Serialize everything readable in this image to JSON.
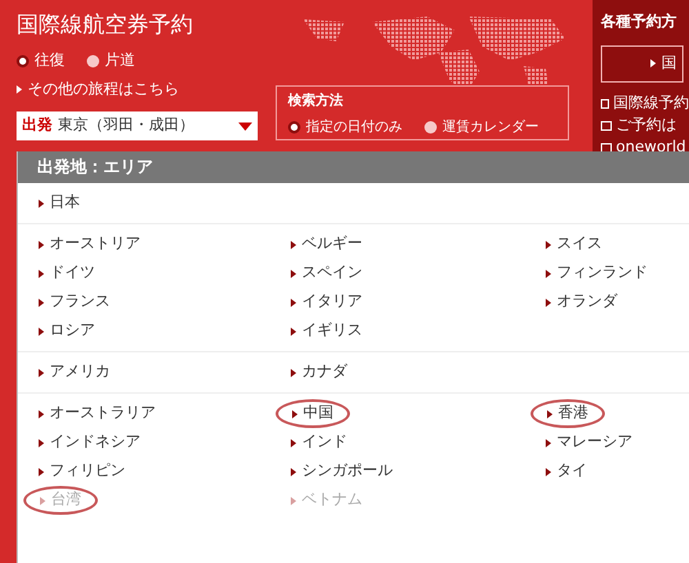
{
  "header": {
    "title": "国際線航空券予約",
    "trip_types": [
      {
        "label": "往復",
        "selected": true
      },
      {
        "label": "片道",
        "selected": false
      }
    ],
    "other_link": "その他の旅程はこちら",
    "departure": {
      "label": "出発",
      "value": "東京（羽田・成田）"
    },
    "search_method": {
      "title": "検索方法",
      "options": [
        {
          "label": "指定の日付のみ",
          "selected": true
        },
        {
          "label": "運賃カレンダー",
          "selected": false
        }
      ]
    }
  },
  "side_panel": {
    "title": "各種予約方",
    "button": "国",
    "links": [
      "国際線予約",
      "ご予約は",
      "oneworld"
    ]
  },
  "dropdown": {
    "title": "出発地：エリア",
    "groups": [
      {
        "items": [
          {
            "label": "日本",
            "disabled": false,
            "circled": false
          }
        ]
      },
      {
        "items": [
          {
            "label": "オーストリア",
            "disabled": false,
            "circled": false
          },
          {
            "label": "ベルギー",
            "disabled": false,
            "circled": false
          },
          {
            "label": "スイス",
            "disabled": false,
            "circled": false
          },
          {
            "label": "ドイツ",
            "disabled": false,
            "circled": false
          },
          {
            "label": "スペイン",
            "disabled": false,
            "circled": false
          },
          {
            "label": "フィンランド",
            "disabled": false,
            "circled": false
          },
          {
            "label": "フランス",
            "disabled": false,
            "circled": false
          },
          {
            "label": "イタリア",
            "disabled": false,
            "circled": false
          },
          {
            "label": "オランダ",
            "disabled": false,
            "circled": false
          },
          {
            "label": "ロシア",
            "disabled": false,
            "circled": false
          },
          {
            "label": "イギリス",
            "disabled": false,
            "circled": false
          }
        ]
      },
      {
        "items": [
          {
            "label": "アメリカ",
            "disabled": false,
            "circled": false
          },
          {
            "label": "カナダ",
            "disabled": false,
            "circled": false
          }
        ]
      },
      {
        "items": [
          {
            "label": "オーストラリア",
            "disabled": false,
            "circled": false
          },
          {
            "label": "中国",
            "disabled": false,
            "circled": true
          },
          {
            "label": "香港",
            "disabled": false,
            "circled": true
          },
          {
            "label": "インドネシア",
            "disabled": false,
            "circled": false
          },
          {
            "label": "インド",
            "disabled": false,
            "circled": false
          },
          {
            "label": "マレーシア",
            "disabled": false,
            "circled": false
          },
          {
            "label": "フィリピン",
            "disabled": false,
            "circled": false
          },
          {
            "label": "シンガポール",
            "disabled": false,
            "circled": false
          },
          {
            "label": "タイ",
            "disabled": false,
            "circled": false
          },
          {
            "label": "台湾",
            "disabled": true,
            "circled": true
          },
          {
            "label": "ベトナム",
            "disabled": true,
            "circled": false
          }
        ]
      }
    ]
  }
}
